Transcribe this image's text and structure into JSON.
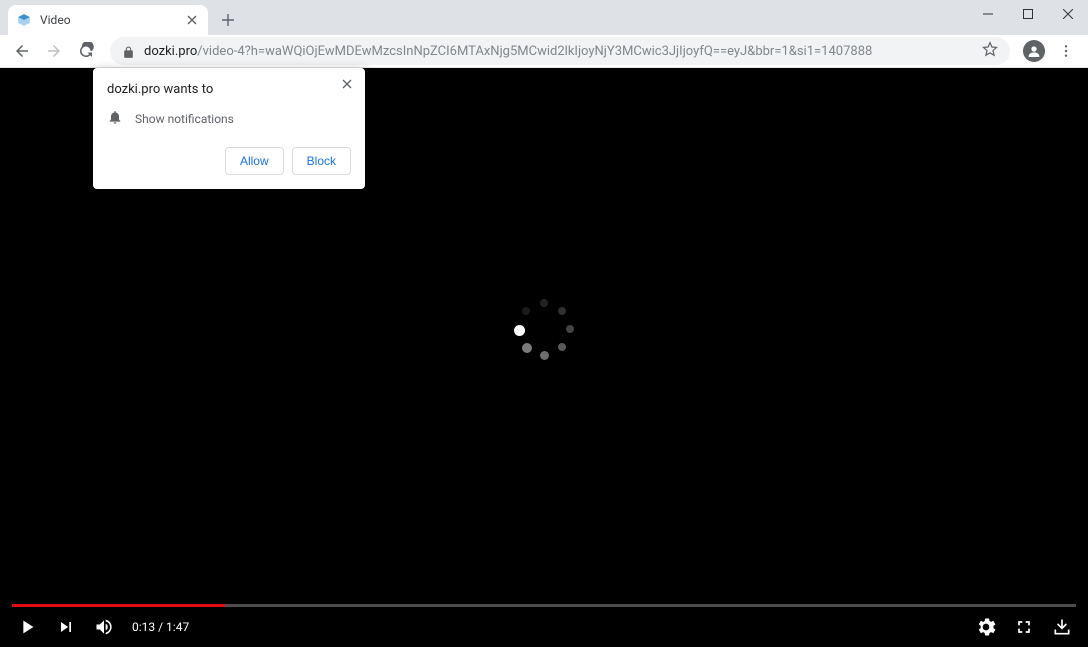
{
  "tab": {
    "title": "Video"
  },
  "url": {
    "domain": "dozki.pro",
    "path": "/video-4?h=waWQiOjEwMDEwMzcsInNpZCI6MTAxNjg5MCwid2lkIjoyNjY3MCwic3JjIjoyfQ==eyJ&bbr=1&si1=1407888"
  },
  "popup": {
    "title": "dozki.pro wants to",
    "permission": "Show notifications",
    "allow": "Allow",
    "block": "Block"
  },
  "video": {
    "current_time": "0:13",
    "duration": "1:47"
  }
}
